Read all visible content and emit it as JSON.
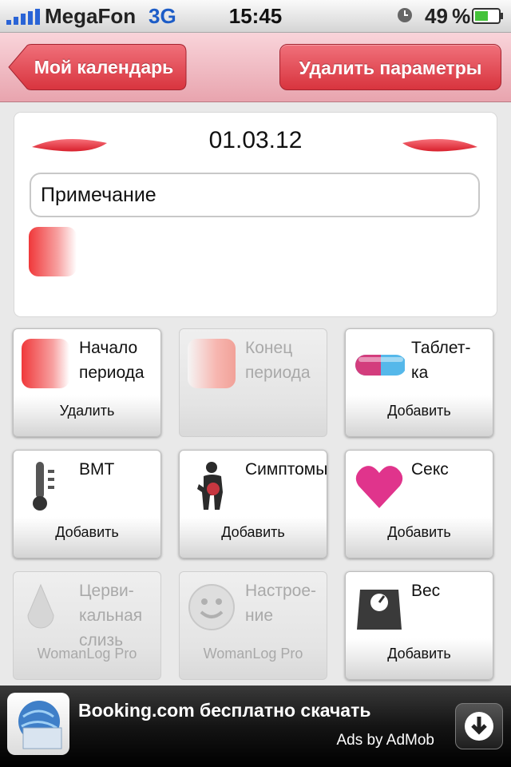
{
  "status_bar": {
    "carrier": "MegaFon",
    "network": "3G",
    "time": "15:45",
    "battery": "49 %"
  },
  "nav": {
    "back_label": "Мой календарь",
    "right_label": "Удалить параметры"
  },
  "date_card": {
    "date": "01.03.12",
    "note_placeholder": "Примечание"
  },
  "tiles": [
    {
      "title": "Начало\nпериода",
      "action": "Удалить",
      "icon": "period-start-icon",
      "enabled": true
    },
    {
      "title": "Конец\nпериода",
      "action": "",
      "icon": "period-end-icon",
      "enabled": false
    },
    {
      "title": "Таблет-\nка",
      "action": "Добавить",
      "icon": "pill-icon",
      "enabled": true
    },
    {
      "title": "BMT",
      "action": "Добавить",
      "icon": "thermometer-icon",
      "enabled": true
    },
    {
      "title": "Симптомы",
      "action": "Добавить",
      "icon": "body-symptoms-icon",
      "enabled": true
    },
    {
      "title": "Секс",
      "action": "Добавить",
      "icon": "heart-icon",
      "enabled": true
    },
    {
      "title": "Церви-\nкальная\nслизь",
      "action": "WomanLog Pro",
      "icon": "droplet-icon",
      "enabled": false
    },
    {
      "title": "Настрое-\nние",
      "action": "WomanLog Pro",
      "icon": "smiley-icon",
      "enabled": false
    },
    {
      "title": "Вес",
      "action": "Добавить",
      "icon": "scale-icon",
      "enabled": true
    }
  ],
  "ad": {
    "headline": "Booking.com бесплатно скачать",
    "byline": "Ads by AdMob",
    "icon": "download-icon"
  },
  "colors": {
    "accent": "#e23a44",
    "nav_bg": "#f2bcc4"
  }
}
